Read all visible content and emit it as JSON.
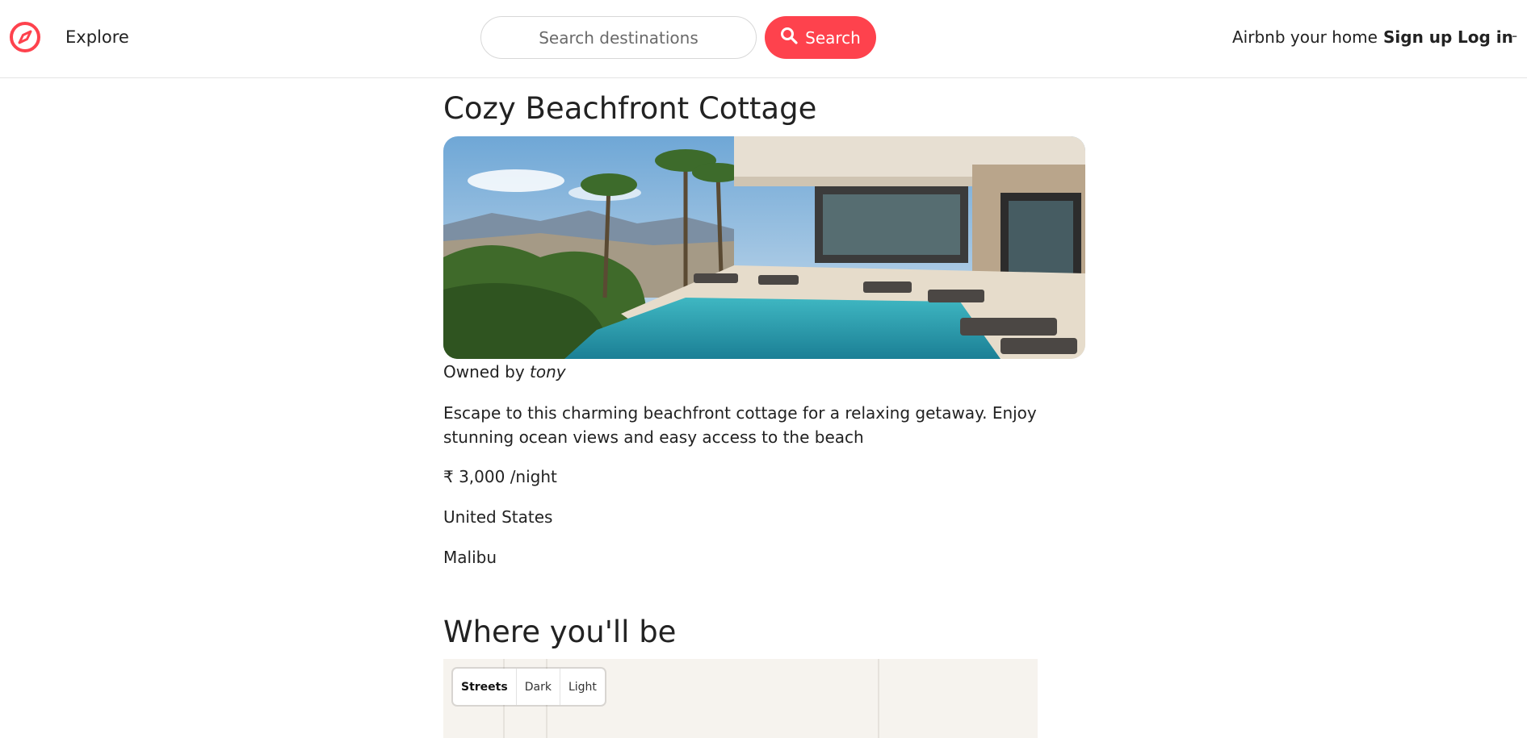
{
  "colors": {
    "brand": "#fe424d",
    "text": "#222222",
    "border": "#e4e4e4",
    "map_background": "#f6f3ee"
  },
  "navbar": {
    "brand_icon": "compass-icon",
    "explore_label": "Explore",
    "search": {
      "placeholder": "Search destinations",
      "value": "",
      "button_label": "Search",
      "button_icon": "search-icon"
    },
    "host_label": "Airbnb your home",
    "signup_label": "Sign up",
    "login_label": "Log in",
    "trailing_text": "-"
  },
  "listing": {
    "title": "Cozy Beachfront Cottage",
    "owner_prefix": "Owned by",
    "owner_name": "tony",
    "description": "Escape to this charming beachfront cottage for a relaxing getaway. Enjoy stunning ocean views and easy access to the beach",
    "price": "₹ 3,000 /night",
    "country": "United States",
    "location": "Malibu"
  },
  "map_section": {
    "heading": "Where you'll be",
    "styles": [
      "Streets",
      "Dark",
      "Light"
    ],
    "active_style": "Streets"
  }
}
